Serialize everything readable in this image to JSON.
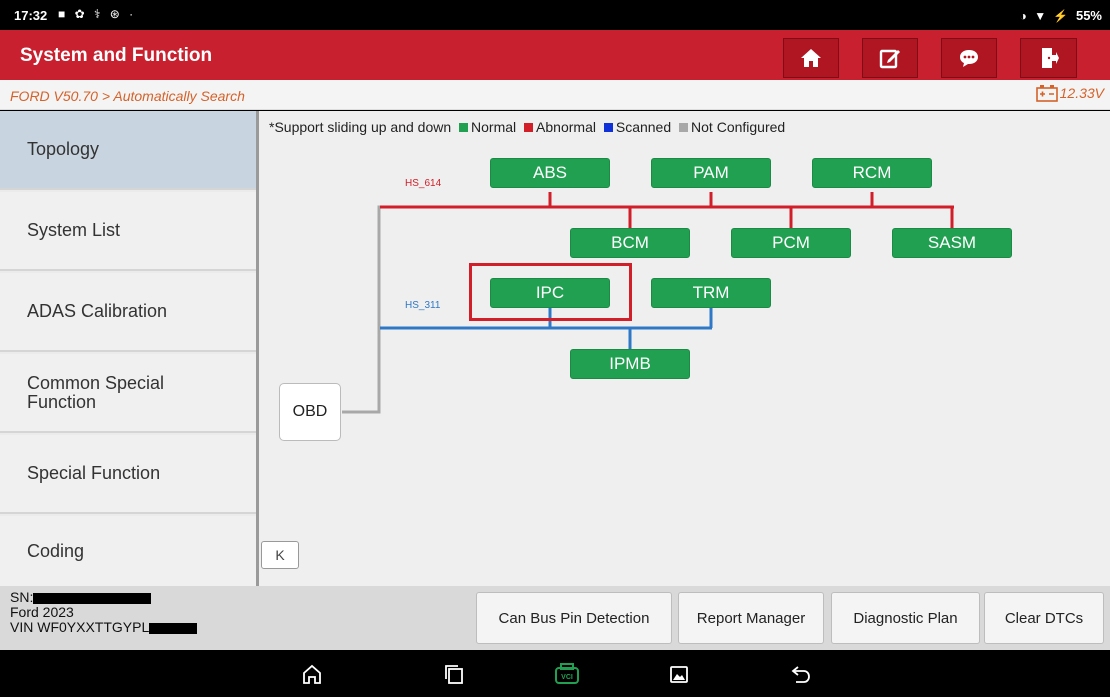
{
  "status_bar": {
    "time": "17:32",
    "left_icons": "■ ✿ ⚕ ⊛ ·",
    "right_icons": "◑ ▼ ⚡",
    "battery": "55%"
  },
  "header": {
    "title": "System and Function",
    "buttons": [
      {
        "icon": "home-icon"
      },
      {
        "icon": "edit-icon"
      },
      {
        "icon": "chat-icon"
      },
      {
        "icon": "exit-icon"
      }
    ]
  },
  "breadcrumb": {
    "text": "FORD V50.70 > Automatically Search",
    "voltage": "12.33V"
  },
  "sidebar": {
    "items": [
      {
        "label": "Topology"
      },
      {
        "label": "System List"
      },
      {
        "label": "ADAS Calibration"
      },
      {
        "label": "Common Special\nFunction"
      },
      {
        "label": "Special Function"
      },
      {
        "label": "Coding"
      }
    ],
    "collapse_glyph": "K"
  },
  "topology": {
    "hint": "*Support sliding up and down",
    "legend": [
      {
        "label": "Normal",
        "color": "#22a052"
      },
      {
        "label": "Abnormal",
        "color": "#d21e28"
      },
      {
        "label": "Scanned",
        "color": "#1030d8"
      },
      {
        "label": "Not Configured",
        "color": "#a8a8a8"
      }
    ],
    "buses": [
      {
        "name": "HS_614",
        "color": "#d21e28"
      },
      {
        "name": "HS_311",
        "color": "#2f78c8"
      }
    ],
    "modules": [
      {
        "name": "ABS"
      },
      {
        "name": "PAM"
      },
      {
        "name": "RCM"
      },
      {
        "name": "BCM"
      },
      {
        "name": "PCM"
      },
      {
        "name": "SASM"
      },
      {
        "name": "IPC"
      },
      {
        "name": "TRM"
      },
      {
        "name": "IPMB"
      }
    ],
    "obd_label": "OBD"
  },
  "vehicle_info": {
    "sn_label": "SN:",
    "model": "Ford  2023",
    "vin_prefix": "VIN WF0YXXTTGYPL"
  },
  "actions": [
    {
      "label": "Can Bus Pin Detection"
    },
    {
      "label": "Report Manager"
    },
    {
      "label": "Diagnostic Plan"
    },
    {
      "label": "Clear DTCs"
    }
  ],
  "nav_bar": [
    {
      "icon": "home-nav-icon"
    },
    {
      "icon": "recent-apps-icon"
    },
    {
      "icon": "vci-icon",
      "label": "VCI",
      "color": "#22a052"
    },
    {
      "icon": "gallery-icon"
    },
    {
      "icon": "back-icon"
    }
  ]
}
